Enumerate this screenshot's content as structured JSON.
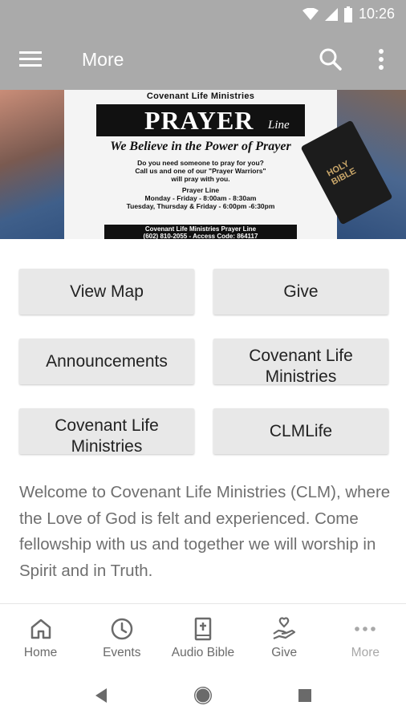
{
  "status_bar": {
    "time": "10:26"
  },
  "app_bar": {
    "title": "More"
  },
  "banner": {
    "org": "Covenant Life Ministries",
    "heading": "PRAYER",
    "heading_script": "Line",
    "tagline": "We Believe in the Power of Prayer",
    "intro_1": "Do you need someone to pray for you?",
    "intro_2": "Call us and one of our \"Prayer Warriors\"",
    "intro_3": "will pray with you.",
    "schedule_title": "Prayer Line",
    "schedule_1": "Monday - Friday - 8:00am - 8:30am",
    "schedule_2": "Tuesday, Thursday & Friday - 6:00pm -6:30pm",
    "footer_1": "Covenant Life Ministries Prayer Line",
    "footer_2": "(602) 810-2055 - Access Code: 864117",
    "book_text": "HOLY BIBLE"
  },
  "buttons": [
    {
      "label": "View Map"
    },
    {
      "label": "Give"
    },
    {
      "label": "Announcements"
    },
    {
      "label": "Covenant Life Ministries"
    },
    {
      "label": "Covenant Life Ministries"
    },
    {
      "label": "CLMLife"
    }
  ],
  "welcome_text": "Welcome to Covenant Life Ministries (CLM), where the Love of God is felt and experienced. Come fellowship with us and together we will worship in Spirit and in Truth.",
  "bottom_nav": [
    {
      "label": "Home",
      "icon": "home-icon"
    },
    {
      "label": "Events",
      "icon": "clock-icon"
    },
    {
      "label": "Audio Bible",
      "icon": "bible-icon"
    },
    {
      "label": "Give",
      "icon": "give-hand-icon"
    },
    {
      "label": "More",
      "icon": "more-dots-icon",
      "active": true
    }
  ],
  "colors": {
    "app_bar": "#aaaaaa",
    "button_bg": "#e8e8e8",
    "nav_label": "#6b6b6b",
    "nav_label_active": "#a8a8a8"
  }
}
